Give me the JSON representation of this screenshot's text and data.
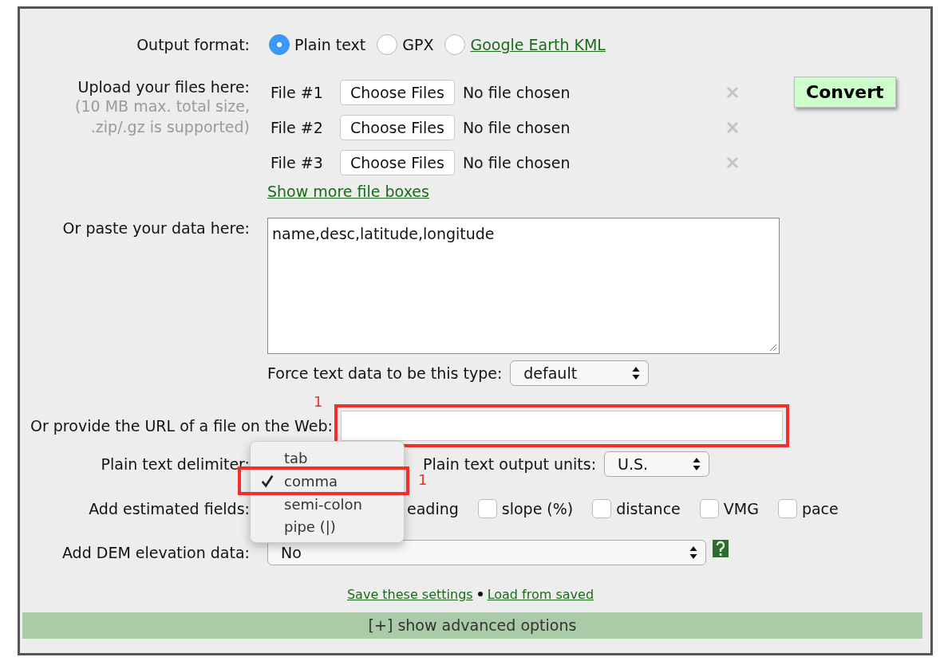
{
  "output_format": {
    "label": "Output format:",
    "options": [
      {
        "label": "Plain text",
        "selected": true,
        "kind": "plain"
      },
      {
        "label": "GPX",
        "selected": false,
        "kind": "plain"
      },
      {
        "label": "Google Earth KML",
        "selected": false,
        "kind": "link"
      }
    ]
  },
  "upload": {
    "label": "Upload your files here:",
    "note": "(10 MB max. total size,\n.zip/.gz is supported)",
    "files": [
      {
        "label": "File #1",
        "button": "Choose Files",
        "status": "No file chosen"
      },
      {
        "label": "File #2",
        "button": "Choose Files",
        "status": "No file chosen"
      },
      {
        "label": "File #3",
        "button": "Choose Files",
        "status": "No file chosen"
      }
    ],
    "more_link": "Show more file boxes",
    "convert_button": "Convert"
  },
  "paste": {
    "label": "Or paste your data here:",
    "value": "name,desc,latitude,longitude",
    "force_type": {
      "label": "Force text data to be this type:",
      "value": "default"
    }
  },
  "url": {
    "label": "Or provide the URL of a file on the Web:",
    "highlighted": true,
    "marker": "1"
  },
  "delimiter": {
    "label": "Plain text delimiter:",
    "options": [
      {
        "label": "tab",
        "selected": false,
        "highlighted": false
      },
      {
        "label": "comma",
        "selected": true,
        "highlighted": true,
        "marker": "1"
      },
      {
        "label": "semi-colon",
        "selected": false,
        "highlighted": false
      },
      {
        "label": "pipe (|)",
        "selected": false,
        "highlighted": false
      }
    ]
  },
  "units": {
    "label": "Plain text output units:",
    "value": "U.S."
  },
  "estimated_fields": {
    "label": "Add estimated fields:",
    "items": [
      {
        "label": "eading",
        "kind": "covered"
      },
      {
        "label": "slope (%)",
        "kind": "checkbox",
        "checked": false
      },
      {
        "label": "distance",
        "kind": "checkbox",
        "checked": false
      },
      {
        "label": "VMG",
        "kind": "checkbox",
        "checked": false
      },
      {
        "label": "pace",
        "kind": "checkbox",
        "checked": false
      }
    ]
  },
  "dem": {
    "label": "Add DEM elevation data:",
    "value": "No"
  },
  "links": [
    {
      "label": "Save these settings"
    },
    {
      "label": "Load from saved"
    }
  ],
  "advanced_toggle": "[+] show advanced options"
}
